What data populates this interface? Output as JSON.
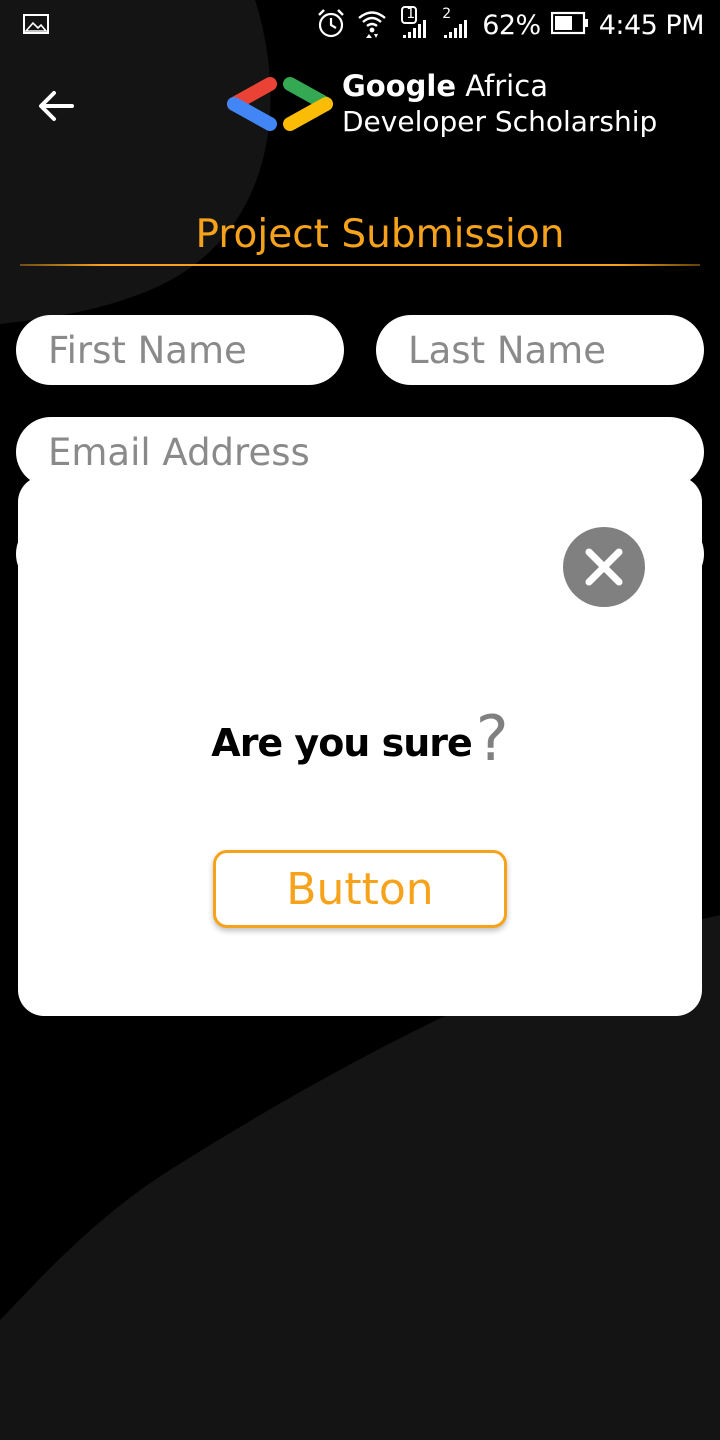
{
  "status_bar": {
    "battery_percent": "62%",
    "time": "4:45 PM",
    "sim1_label": "1",
    "sim2_label": "2",
    "icons": [
      "image-icon",
      "alarm-icon",
      "wifi-icon",
      "signal-icon",
      "battery-icon"
    ]
  },
  "header": {
    "back_icon": "arrow-left-icon",
    "brand_line1_bold": "Google",
    "brand_line1_rest": " Africa",
    "brand_line2": "Developer Scholarship"
  },
  "page": {
    "title": "Project Submission",
    "accent_color": "#F7A21B"
  },
  "form": {
    "first_name_placeholder": "First Name",
    "last_name_placeholder": "Last Name",
    "email_placeholder": "Email Address"
  },
  "dialog": {
    "close_icon": "close-icon",
    "message": "Are you sure",
    "question_mark": "?",
    "button_label": "Button"
  }
}
